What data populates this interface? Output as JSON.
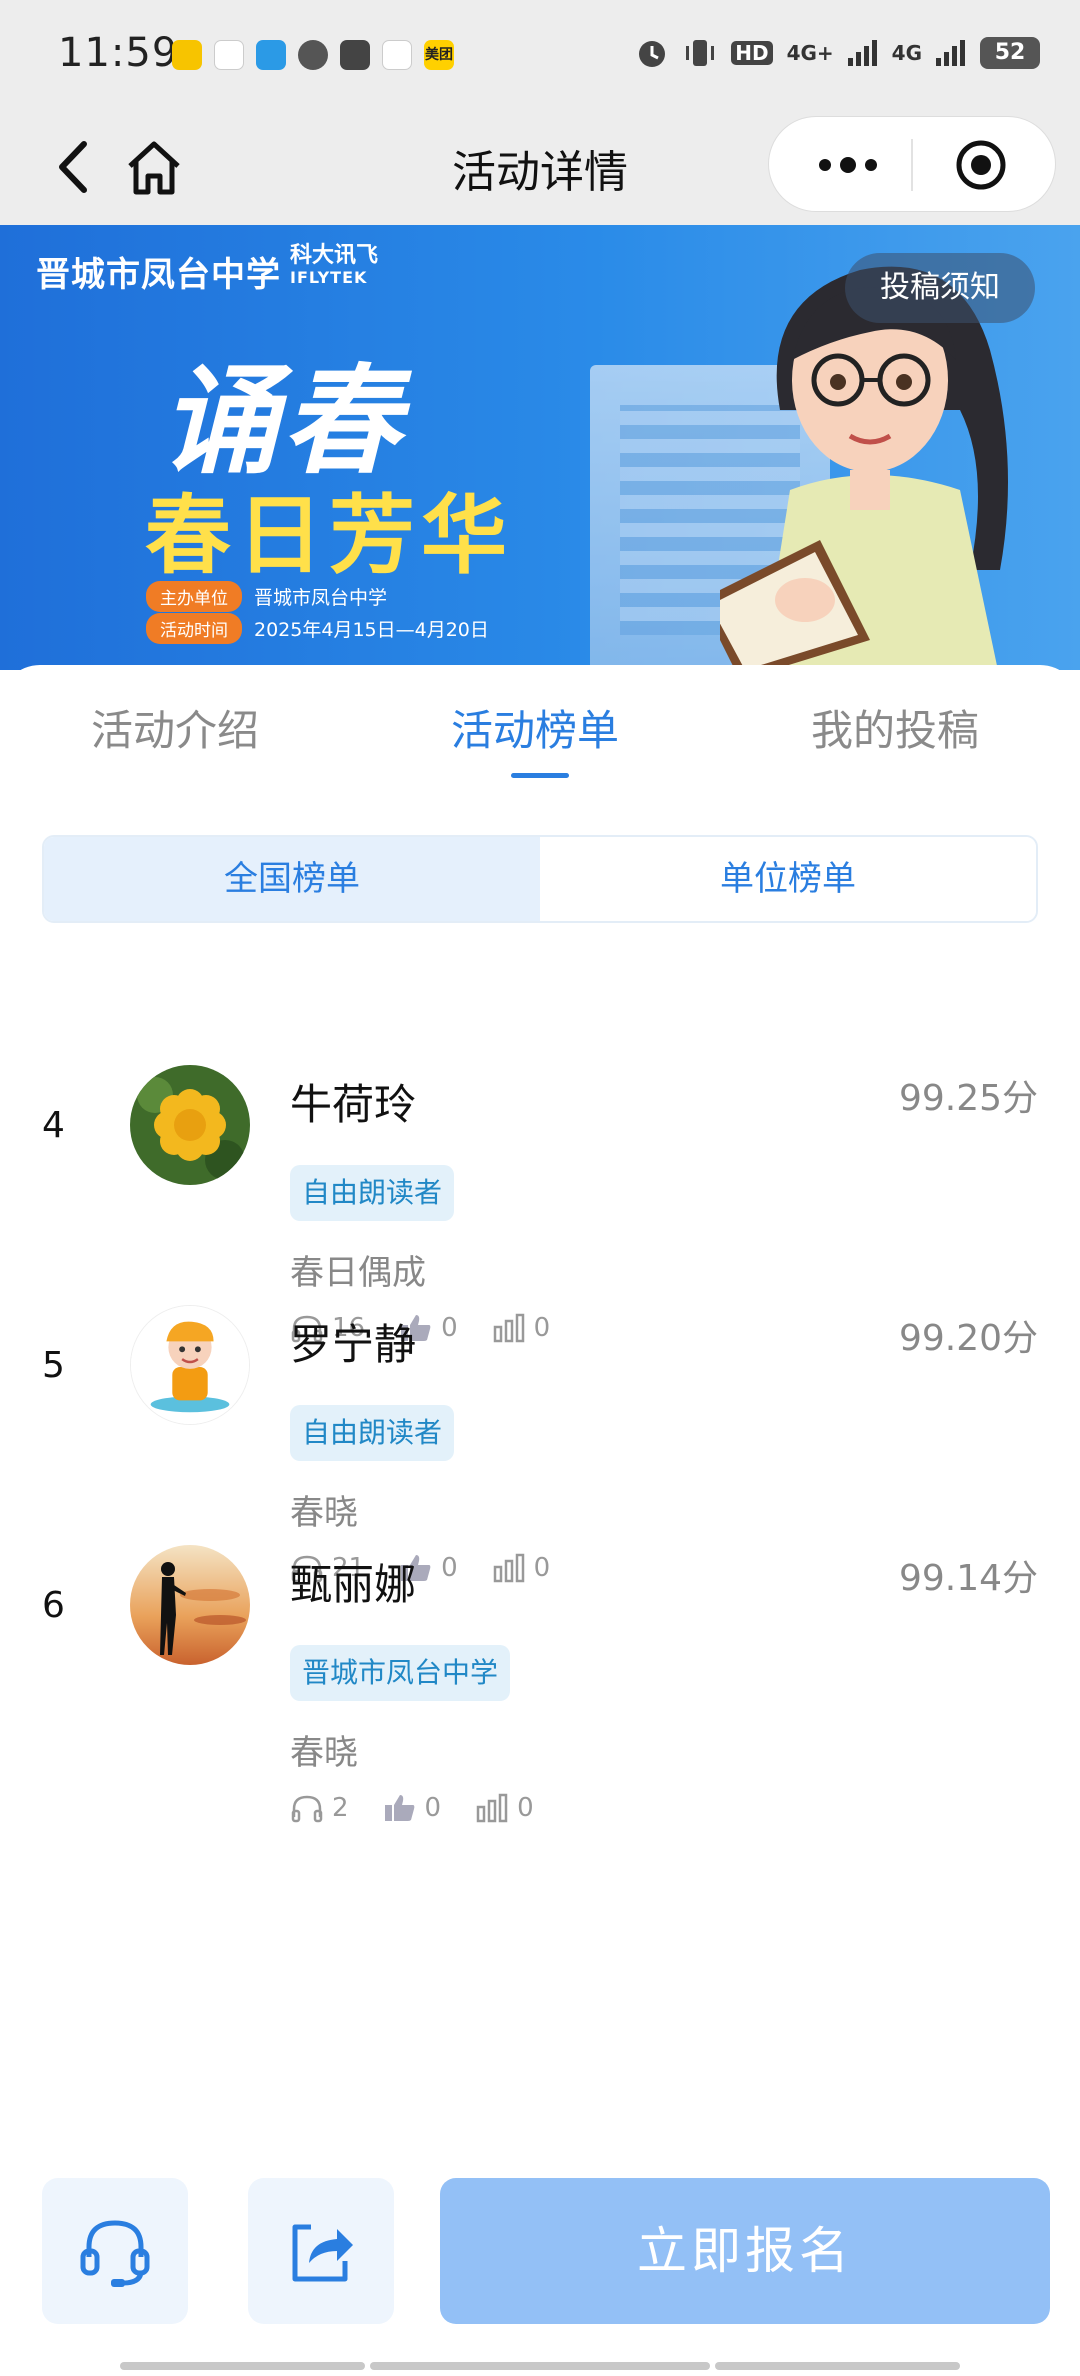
{
  "status": {
    "time": "11:59",
    "app_labels": [
      "美团"
    ],
    "hd": "HD",
    "net1": "4G+",
    "net2": "4G",
    "battery": "52"
  },
  "nav": {
    "title": "活动详情"
  },
  "banner": {
    "brand": "晋城市凤台中学",
    "brand_partner": "科大讯飞",
    "brand_partner_en": "IFLYTEK",
    "title_line1": "诵春",
    "title_line2": "春日芳华",
    "host_label": "主办单位",
    "host_value": "晋城市凤台中学",
    "time_label": "活动时间",
    "time_value": "2025年4月15日—4月20日",
    "notice_button": "投稿须知"
  },
  "tabs": [
    {
      "label": "活动介绍",
      "active": false
    },
    {
      "label": "活动榜单",
      "active": true
    },
    {
      "label": "我的投稿",
      "active": false
    }
  ],
  "segments": [
    {
      "label": "全国榜单",
      "active": true
    },
    {
      "label": "单位榜单",
      "active": false
    }
  ],
  "entries": [
    {
      "rank": "4",
      "name": "牛荷玲",
      "score": "99.25分",
      "tag": "自由朗读者",
      "title": "春日偶成",
      "listens": "16",
      "likes": "0",
      "votes": "0",
      "avatar": "flower"
    },
    {
      "rank": "5",
      "name": "罗宁静",
      "score": "99.20分",
      "tag": "自由朗读者",
      "title": "春晓",
      "listens": "21",
      "likes": "0",
      "votes": "0",
      "avatar": "cartoon-boy"
    },
    {
      "rank": "6",
      "name": "甄丽娜",
      "score": "99.14分",
      "tag": "晋城市凤台中学",
      "title": "春晓",
      "listens": "2",
      "likes": "0",
      "votes": "0",
      "avatar": "sunset-silhouette"
    }
  ],
  "footer": {
    "support_icon": "headset-icon",
    "share_icon": "share-icon",
    "signup_label": "立即报名"
  },
  "colors": {
    "accent": "#2a7ee0",
    "signup_bg": "#93c0f6",
    "tag_bg": "#e3f1fa",
    "tag_text": "#2188c6",
    "banner_bg": "#1f6fd9",
    "banner_title2": "#ffe04a"
  }
}
